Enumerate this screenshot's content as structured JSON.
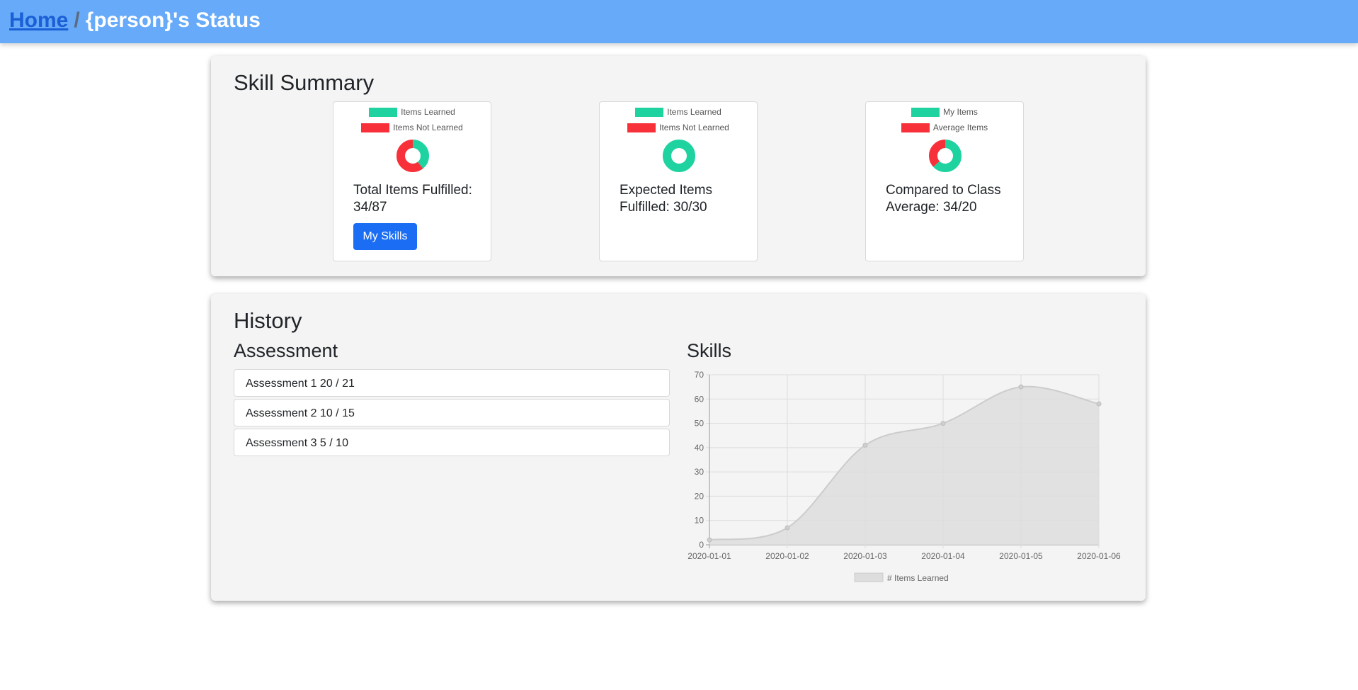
{
  "header": {
    "home_link": "Home",
    "separator": "/",
    "title": "{person}'s Status"
  },
  "summary": {
    "heading": "Skill Summary",
    "cards": [
      {
        "legend": [
          "Items Learned",
          "Items Not Learned"
        ],
        "values": [
          34,
          53
        ],
        "text": "Total Items Fulfilled: 34/87",
        "button": "My Skills"
      },
      {
        "legend": [
          "Items Learned",
          "Items Not Learned"
        ],
        "values": [
          30,
          0
        ],
        "text": "Expected Items Fulfilled: 30/30"
      },
      {
        "legend": [
          "My Items",
          "Average Items"
        ],
        "values": [
          34,
          20
        ],
        "text": "Compared to Class Average: 34/20"
      }
    ],
    "colors": {
      "learned": "#1fd3a0",
      "not_learned": "#f7303a"
    }
  },
  "history": {
    "heading": "History",
    "assessment_heading": "Assessment",
    "assessments": [
      "Assessment 1 20 / 21",
      "Assessment 2 10 / 15",
      "Assessment 3 5 / 10"
    ],
    "skills_heading": "Skills"
  },
  "chart_data": {
    "type": "area",
    "x": [
      "2020-01-01",
      "2020-01-02",
      "2020-01-03",
      "2020-01-04",
      "2020-01-05",
      "2020-01-06"
    ],
    "series": [
      {
        "name": "# Items Learned",
        "values": [
          2,
          7,
          41,
          50,
          65,
          58
        ]
      }
    ],
    "ylim": [
      0,
      70
    ],
    "yticks": [
      0,
      10,
      20,
      30,
      40,
      50,
      60,
      70
    ],
    "grid": true,
    "legend": "bottom",
    "fill_color": "#dddddd",
    "line_color": "#cccccc"
  }
}
